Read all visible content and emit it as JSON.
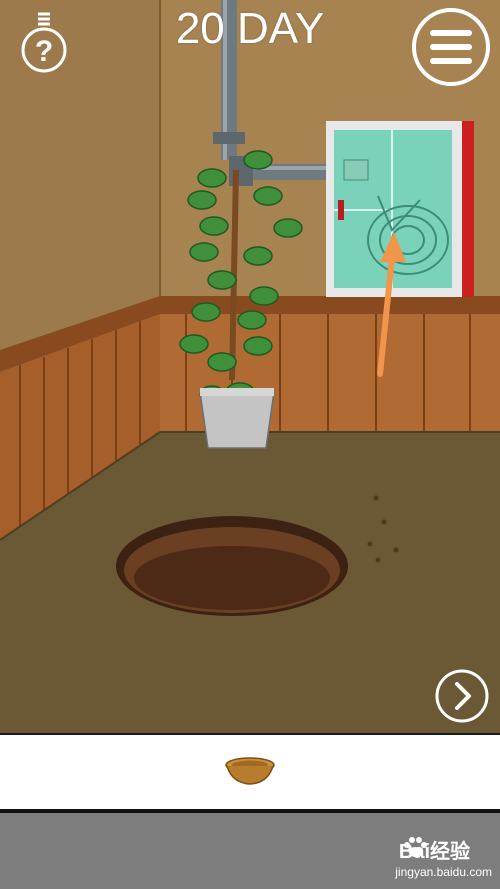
{
  "header": {
    "day_label": "20 DAY"
  },
  "icons": {
    "hint": "lightbulb-question-icon",
    "menu": "hamburger-menu-icon",
    "next": "chevron-right-icon"
  },
  "scene": {
    "objects": [
      "pipe",
      "potted-plant",
      "hose-cabinet",
      "hole",
      "footprints",
      "orange-arrow"
    ],
    "colors": {
      "wall": "#a78352",
      "wainscot": "#a8612c",
      "floor": "#6b5834",
      "arrow": "#f0954a",
      "cabinet_glass": "#6fcfb6",
      "cabinet_frame": "#cc1f1f"
    }
  },
  "inventory": {
    "items": [
      "bowl"
    ]
  },
  "watermark": {
    "brand": "Bai经验",
    "url": "jingyan.baidu.com"
  }
}
